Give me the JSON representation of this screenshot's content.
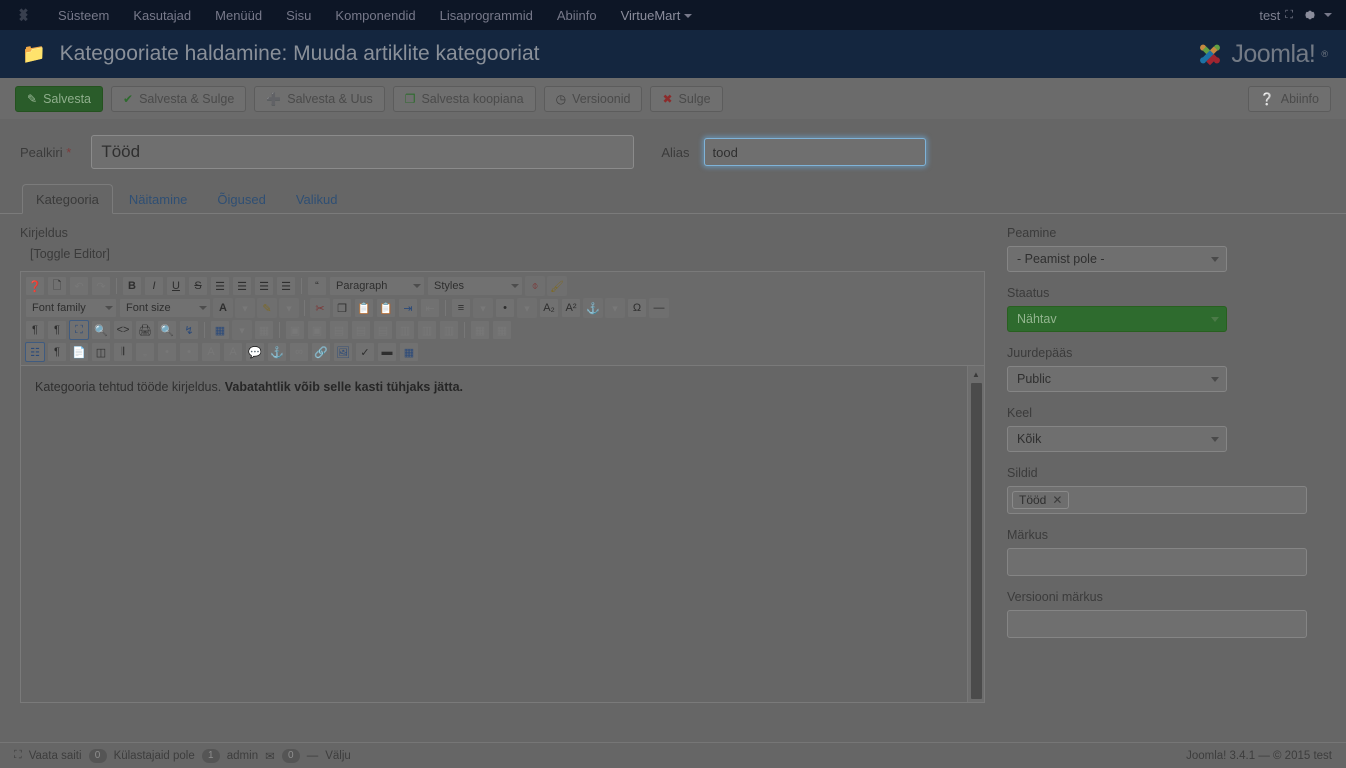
{
  "topbar": {
    "brand_icon": "joomla-icon",
    "menu": [
      {
        "label": "Süsteem"
      },
      {
        "label": "Kasutajad"
      },
      {
        "label": "Menüüd"
      },
      {
        "label": "Sisu"
      },
      {
        "label": "Komponendid"
      },
      {
        "label": "Lisaprogrammid"
      },
      {
        "label": "Abiinfo"
      },
      {
        "label": "VirtueMart"
      }
    ],
    "user_label": "test",
    "user_icon": "external-link-icon",
    "gear_icon": "gear-icon"
  },
  "header": {
    "icon": "folder-icon",
    "title": "Kategooriate haldamine: Muuda artiklite kategooriat",
    "logo_text": "Joomla!",
    "logo_reg": "®"
  },
  "toolbar": {
    "buttons": [
      {
        "label": "Salvesta",
        "icon": "edit-pencil-icon",
        "style": "primary"
      },
      {
        "label": "Salvesta & Sulge",
        "icon": "check-icon",
        "style": "default"
      },
      {
        "label": "Salvesta & Uus",
        "icon": "plus-icon",
        "style": "default"
      },
      {
        "label": "Salvesta koopiana",
        "icon": "copy-icon",
        "style": "default"
      },
      {
        "label": "Versioonid",
        "icon": "archive-icon",
        "style": "default"
      },
      {
        "label": "Sulge",
        "icon": "close-circle-icon",
        "style": "default"
      }
    ],
    "help": {
      "label": "Abiinfo",
      "icon": "question-circle-icon"
    }
  },
  "form": {
    "title_label": "Pealkiri",
    "title_required_mark": "*",
    "title_value": "Tööd",
    "alias_label": "Alias",
    "alias_value": "tood"
  },
  "tabs": [
    {
      "label": "Kategooria",
      "active": true
    },
    {
      "label": "Näitamine",
      "active": false
    },
    {
      "label": "Õigused",
      "active": false
    },
    {
      "label": "Valikud",
      "active": false
    }
  ],
  "editor": {
    "section_label": "Kirjeldus",
    "toggle_label": "[Toggle Editor]",
    "paragraph_select": "Paragraph",
    "styles_select": "Styles",
    "font_family_select": "Font family",
    "font_size_select": "Font size",
    "content_plain": "Kategooria tehtud tööde kirjeldus. ",
    "content_bold": "Vabatahtlik võib selle kasti tühjaks jätta.",
    "scroll_up_icon": "scroll-up-arrow-icon"
  },
  "sidebar": {
    "parent_label": "Peamine",
    "parent_value": "- Peamist pole -",
    "status_label": "Staatus",
    "status_value": "Nähtav",
    "access_label": "Juurdepääs",
    "access_value": "Public",
    "language_label": "Keel",
    "language_value": "Kõik",
    "tags_label": "Sildid",
    "tags": [
      {
        "label": "Tööd",
        "remove_icon": "remove-tag-icon"
      }
    ],
    "note_label": "Märkus",
    "note_value": "",
    "version_note_label": "Versiooni märkus",
    "version_note_value": ""
  },
  "statusbar": {
    "view_site": "Vaata saiti",
    "view_site_icon": "external-link-icon",
    "visitors_count": "0",
    "visitors_label": "Külastajaid pole",
    "admins_count": "1",
    "admin_label": "admin",
    "mail_icon": "envelope-icon",
    "messages_count": "0",
    "separator": "—",
    "logout_label": "Välju",
    "copyright": "Joomla! 3.4.1  —  © 2015 test"
  },
  "colors": {
    "topbar_bg": "#0d1626",
    "header_bg": "#14263f",
    "primary_green": "#2e6b2e",
    "focus_blue": "#7fb3d8",
    "overlay_gray": "#666666"
  }
}
